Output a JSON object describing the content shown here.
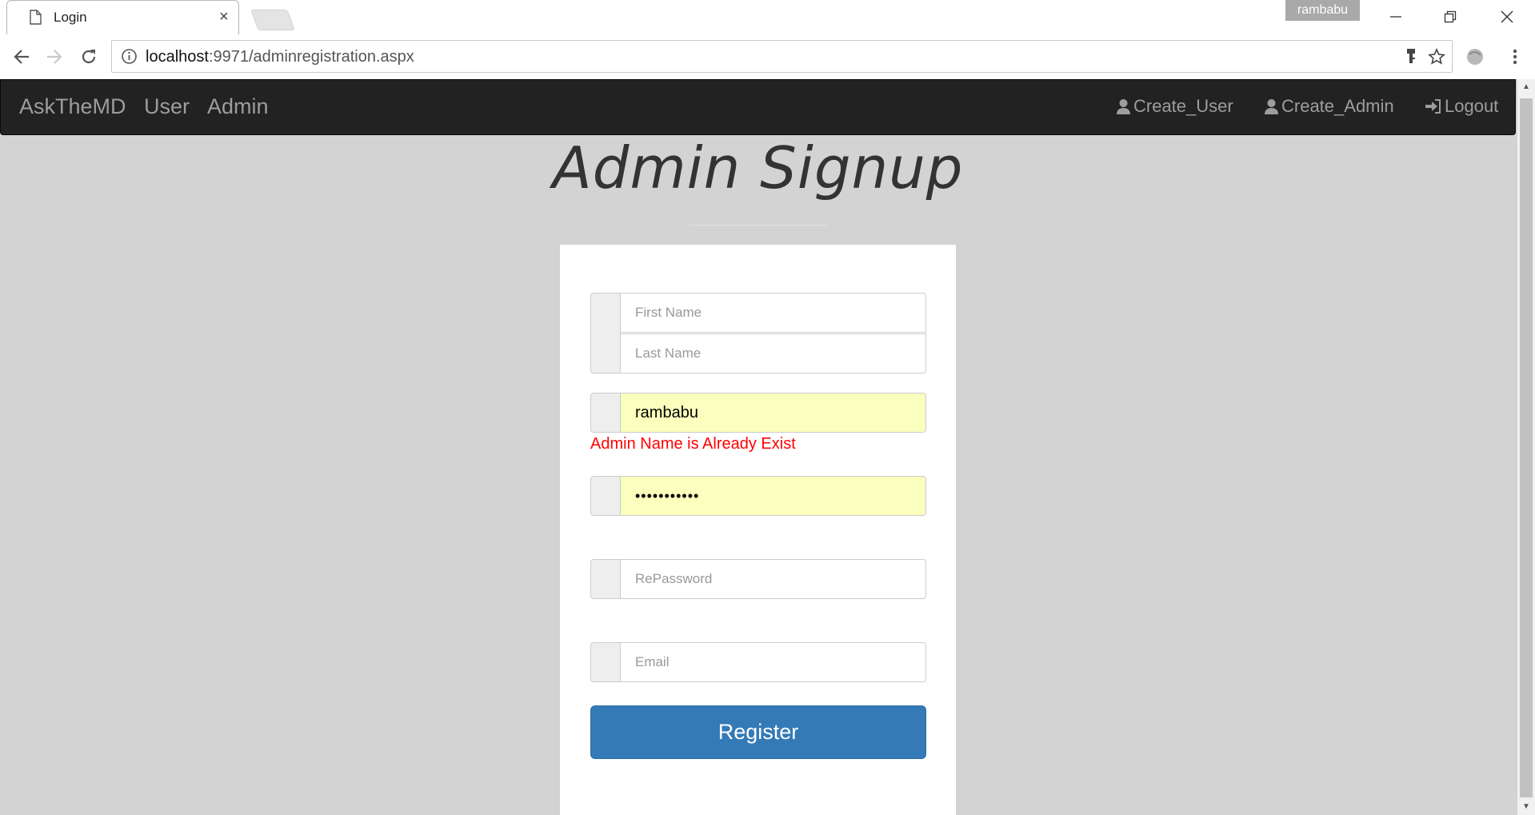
{
  "browser": {
    "tab_title": "Login",
    "tab_close": "×",
    "profile_name": "rambabu",
    "url_host": "localhost",
    "url_rest": ":9971/adminregistration.aspx"
  },
  "navbar": {
    "brand": "AskTheMD",
    "links": [
      "User",
      "Admin"
    ],
    "right_links": [
      "Create_User",
      "Create_Admin",
      "Logout"
    ]
  },
  "page": {
    "title": "Admin Signup"
  },
  "form": {
    "first_name_placeholder": "First Name",
    "last_name_placeholder": "Last Name",
    "admin_name_value": "rambabu",
    "error_message": "Admin Name is Already Exist",
    "password_value": "•••••••••••",
    "repassword_placeholder": "RePassword",
    "email_placeholder": "Email",
    "register_label": "Register"
  },
  "colors": {
    "navbar_bg": "#222222",
    "page_bg": "#d3d3d3",
    "autofill_bg": "#faffbd",
    "error": "#ff0000",
    "primary_button": "#337ab7"
  }
}
